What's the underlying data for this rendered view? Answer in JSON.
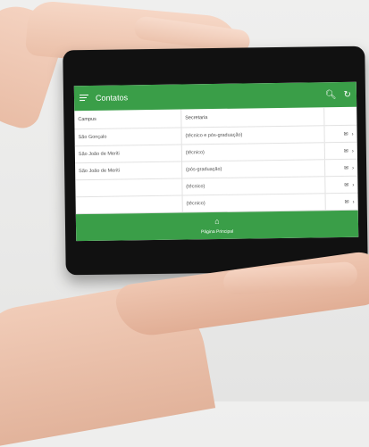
{
  "app": {
    "title": "Contatos",
    "accent_color": "#3a9e48",
    "icons": [
      "menu-icon",
      "search-icon",
      "refresh-icon"
    ]
  },
  "table": {
    "headers": [
      "Campus",
      "Secretaria"
    ],
    "rows": [
      {
        "campus": "São Gonçalo",
        "secretaria": "(técnico e pós-graduação)"
      },
      {
        "campus": "São João de Meriti",
        "secretaria": "(técnico)"
      },
      {
        "campus": "São João de Meriti",
        "secretaria": "(pós-graduação)"
      },
      {
        "campus": "",
        "secretaria": "(técnico)"
      },
      {
        "campus": "",
        "secretaria": "(técnico)"
      }
    ],
    "row_icons": [
      "mail-icon",
      "chevron-right-icon"
    ]
  },
  "bottom_nav": {
    "label": "Página Principal",
    "icon": "home-icon"
  }
}
